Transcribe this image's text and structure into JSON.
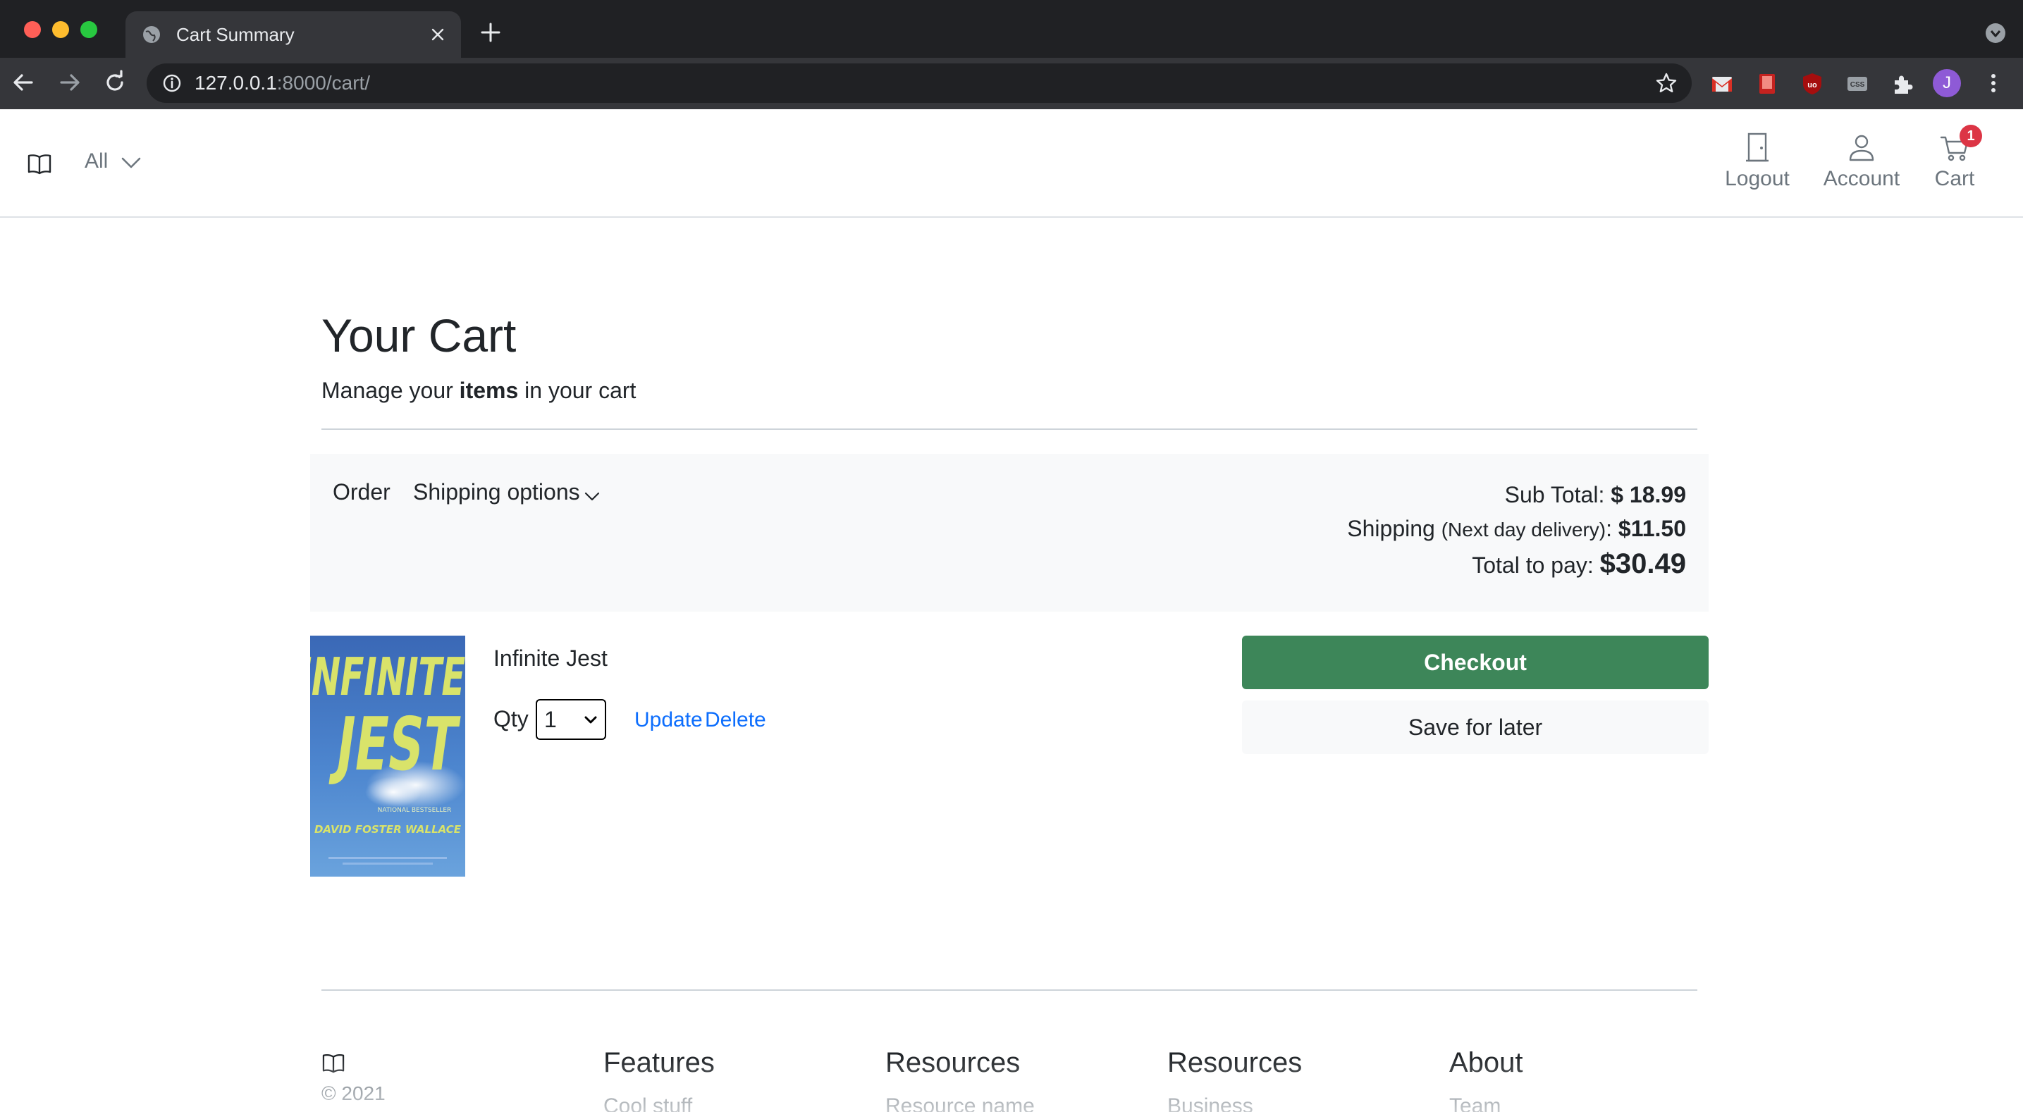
{
  "browser": {
    "tab_title": "Cart Summary",
    "url_host": "127.0.0.1",
    "url_rest": ":8000/cart/",
    "profile_initial": "J"
  },
  "header": {
    "category": "All",
    "logout_label": "Logout",
    "account_label": "Account",
    "cart_label": "Cart",
    "cart_count": "1"
  },
  "page": {
    "title": "Your Cart",
    "subtitle_pre": "Manage your ",
    "subtitle_bold": "items",
    "subtitle_post": " in your cart"
  },
  "summary": {
    "order_label": "Order",
    "shipping_options_label": "Shipping options",
    "subtotal_label": "Sub Total: ",
    "subtotal_value": "$ 18.99",
    "shipping_label": "Shipping ",
    "shipping_method": "(Next day delivery)",
    "shipping_colon": ": ",
    "shipping_value": "$11.50",
    "total_label": "Total to pay: ",
    "total_value": "$30.49"
  },
  "item": {
    "title": "Infinite Jest",
    "cover_title_1": "INFINITE",
    "cover_title_2": "JEST",
    "cover_tagline": "NATIONAL BESTSELLER",
    "cover_author": "DAVID FOSTER WALLACE",
    "qty_label": "Qty",
    "qty_value": "1",
    "update_label": "Update",
    "delete_label": "Delete"
  },
  "actions": {
    "checkout_label": "Checkout",
    "save_label": "Save for later"
  },
  "footer": {
    "copyright": "© 2021",
    "columns": [
      {
        "heading": "Features",
        "link": "Cool stuff"
      },
      {
        "heading": "Resources",
        "link": "Resource name"
      },
      {
        "heading": "Resources",
        "link": "Business"
      },
      {
        "heading": "About",
        "link": "Team"
      }
    ]
  },
  "colors": {
    "checkout": "#3d8659",
    "link": "#0d6efd",
    "badge": "#dc3545",
    "book_cover": "#4d86cf",
    "book_text": "#d9e36a"
  }
}
